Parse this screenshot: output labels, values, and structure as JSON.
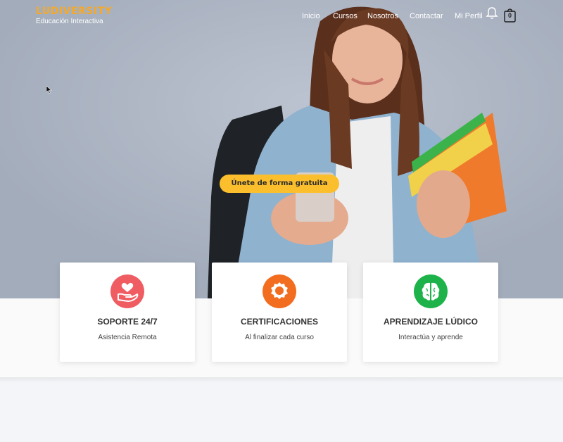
{
  "brand": {
    "name": "LUDIVERSITY",
    "tagline": "Educación Interactiva"
  },
  "nav": {
    "links": [
      "Inicio",
      "Cursos",
      "Nosotros",
      "Contactar",
      "Mi Perfil"
    ],
    "cart_count": "0"
  },
  "hero": {
    "cta_label": "Únete de forma gratuita"
  },
  "features": [
    {
      "title": "SOPORTE 24/7",
      "subtitle": "Asistencia Remota",
      "icon": "heart-hand-icon",
      "color": "#ef5d63"
    },
    {
      "title": "CERTIFICACIONES",
      "subtitle": "Al finalizar cada curso",
      "icon": "badge-icon",
      "color": "#f26d1f"
    },
    {
      "title": "APRENDIZAJE LÚDICO",
      "subtitle": "Interactúa y aprende",
      "icon": "brain-icon",
      "color": "#1db34a"
    }
  ],
  "colors": {
    "accent": "#fbbf2e",
    "logo": "#f6a928"
  }
}
